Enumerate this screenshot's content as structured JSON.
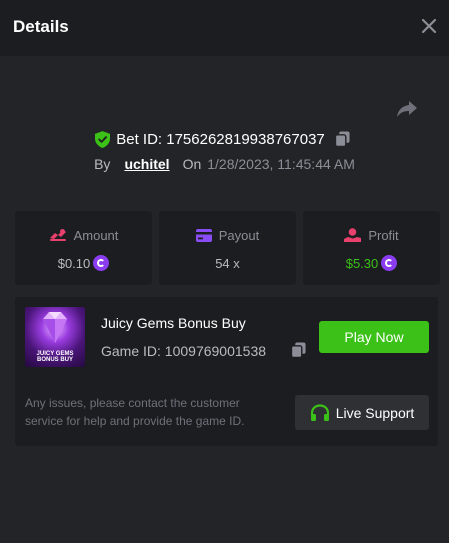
{
  "header": {
    "title": "Details",
    "close_icon": "close-icon"
  },
  "bet": {
    "id_text": "Bet ID: 1756262819938767037",
    "by_label": "By",
    "username": "uchitel",
    "on_label": "On",
    "datetime": "1/28/2023, 11:45:44 AM"
  },
  "stats": {
    "amount": {
      "label": "Amount",
      "value": "$0.10",
      "icon": "amount-icon",
      "color": "#e8416e"
    },
    "payout": {
      "label": "Payout",
      "value": "54 x",
      "icon": "card-icon",
      "color": "#8a4df5"
    },
    "profit": {
      "label": "Profit",
      "value": "$5.30",
      "icon": "profit-icon",
      "color": "#e8416e",
      "value_color": "#3bc117"
    }
  },
  "game": {
    "name": "Juicy Gems Bonus Buy",
    "thumb_text": "JUICY GEMS BONUS BUY",
    "id_text": "Game ID: 1009769001538",
    "play_label": "Play Now",
    "issues_text": "Any issues, please contact the customer service for help and provide the game ID.",
    "support_label": "Live Support"
  },
  "colors": {
    "accent_green": "#3bc117",
    "coin_purple": "#8a3df0",
    "background": "#232427",
    "panel": "#1c1d20"
  }
}
